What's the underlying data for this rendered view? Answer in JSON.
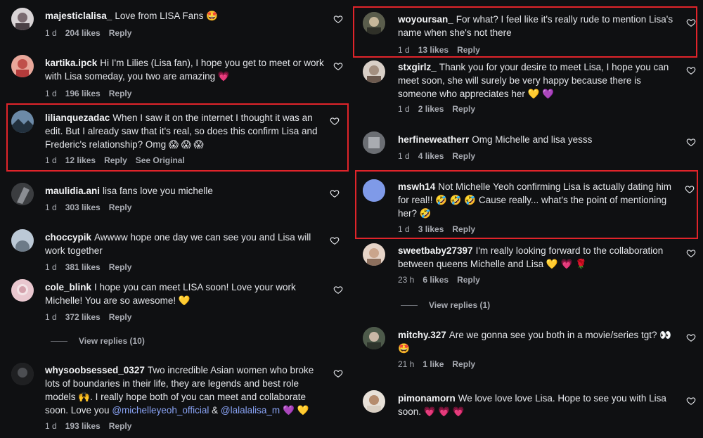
{
  "left": [
    {
      "user": "majesticlalisa_",
      "text": "Love from LISA Fans 🤩",
      "time": "1 d",
      "likes": "204 likes",
      "reply": "Reply"
    },
    {
      "user": "kartika.ipck",
      "text": "Hi I'm Lilies (Lisa fan), I hope you get to meet or work with Lisa someday, you two are amazing 💗",
      "time": "1 d",
      "likes": "196 likes",
      "reply": "Reply"
    },
    {
      "user": "lilianquezadac",
      "text": "When I saw it on the internet I thought it was an edit. But I already saw that it's real, so does this confirm Lisa and Frederic's relationship? Omg 😱 😱 😱",
      "time": "1 d",
      "likes": "12 likes",
      "reply": "Reply",
      "extra": "See Original"
    },
    {
      "user": "maulidia.ani",
      "text": "lisa fans love you michelle",
      "time": "1 d",
      "likes": "303 likes",
      "reply": "Reply"
    },
    {
      "user": "choccypik",
      "text": "Awwww hope one day we can see you and Lisa will work together",
      "time": "1 d",
      "likes": "381 likes",
      "reply": "Reply"
    },
    {
      "user": "cole_blink",
      "text": "I hope you can meet LISA soon! Love your work Michelle! You are so awesome! 💛",
      "time": "1 d",
      "likes": "372 likes",
      "reply": "Reply"
    },
    {
      "user": "whysoobsessed_0327",
      "text": "Two incredible Asian women who broke lots of boundaries in their life, they are legends and best role models 🙌. I really hope both of you can meet and collaborate soon. Love you",
      "mention1": "@michelleyeoh_official",
      "amp": "&",
      "mention2": "@lalalalisa_m",
      "tail": "💜 💛",
      "time": "1 d",
      "likes": "193 likes",
      "reply": "Reply"
    }
  ],
  "left_view_replies": "View replies (10)",
  "right": [
    {
      "user": "woyoursan_",
      "text": "For what? I feel like it's really rude to mention Lisa's name when she's not there",
      "time": "1 d",
      "likes": "13 likes",
      "reply": "Reply"
    },
    {
      "user": "stxgirlz_",
      "text": "Thank you for your desire to meet Lisa, I hope you can meet soon, she will surely be very happy because there is someone who appreciates her 💛 💜",
      "time": "1 d",
      "likes": "2 likes",
      "reply": "Reply"
    },
    {
      "user": "herfineweatherr",
      "text": "Omg Michelle and lisa yesss",
      "time": "1 d",
      "likes": "4 likes",
      "reply": "Reply"
    },
    {
      "user": "mswh14",
      "text": "Not Michelle Yeoh confirming Lisa is actually dating him for real!! 🤣 🤣 🤣 Cause really... what's the point of mentioning her? 🤣",
      "time": "1 d",
      "likes": "3 likes",
      "reply": "Reply"
    },
    {
      "user": "sweetbaby27397",
      "text": "I'm really looking forward to the collaboration between queens Michelle and Lisa 💛 💗 🌹",
      "time": "23 h",
      "likes": "6 likes",
      "reply": "Reply"
    },
    {
      "user": "mitchy.327",
      "text": "Are we gonna see you both in a movie/series tgt? 👀 🤩",
      "time": "21 h",
      "likes": "1 like",
      "reply": "Reply"
    },
    {
      "user": "pimonamorn",
      "text": "We love love love Lisa. Hope to see you with Lisa soon. 💗 💗 💗"
    }
  ],
  "right_view_replies": "View replies (1)",
  "colors": {
    "highlight": "#e0242a",
    "background": "#0f1012",
    "muted": "#a8abb2",
    "mention": "#8aa4f6"
  }
}
